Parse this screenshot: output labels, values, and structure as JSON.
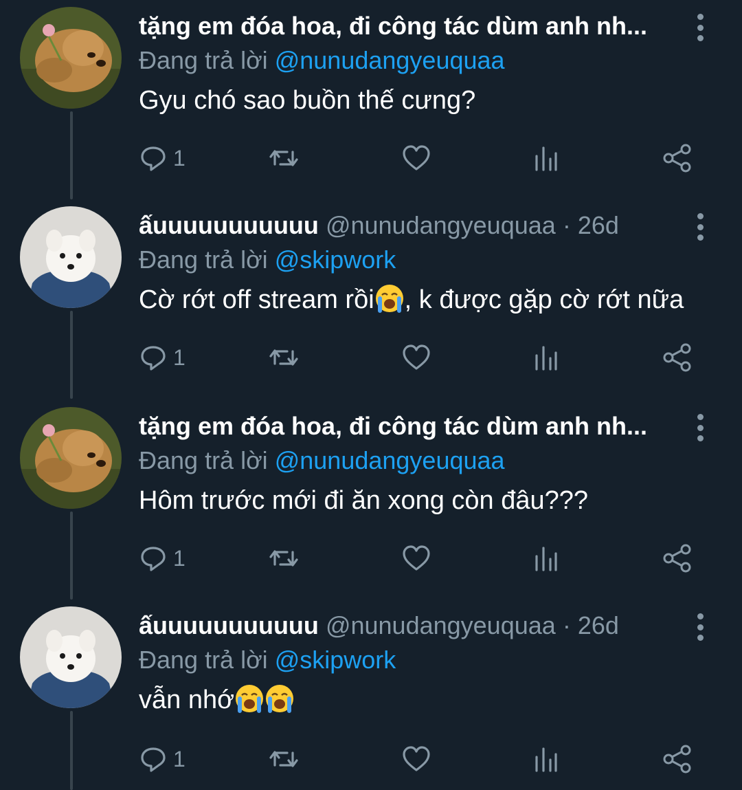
{
  "tweets": [
    {
      "display_name": "tặng em đóa hoa, đi công tác dùm anh nh...",
      "handle": "",
      "time": "",
      "reply_prefix": "Đang trả lời",
      "reply_target": "@nunudangyeuquaa",
      "text_before": "Gyu chó sao buồn thế cưng?",
      "emojis": 0,
      "text_after": "",
      "reply_count": "1",
      "avatar": "golden-retriever-avatar"
    },
    {
      "display_name": "ấuuuuuuuuuuu",
      "handle": "@nunudangyeuquaa",
      "time": "26d",
      "reply_prefix": "Đang trả lời",
      "reply_target": "@skipwork",
      "text_before": "Cờ rớt off stream rồi",
      "emojis": 1,
      "text_after": ", k được gặp cờ rớt nữa",
      "reply_count": "1",
      "avatar": "samoyed-avatar"
    },
    {
      "display_name": "tặng em đóa hoa, đi công tác dùm anh nh...",
      "handle": "",
      "time": "",
      "reply_prefix": "Đang trả lời",
      "reply_target": "@nunudangyeuquaa",
      "text_before": "Hôm trước mới đi ăn xong còn đâu???",
      "emojis": 0,
      "text_after": "",
      "reply_count": "1",
      "avatar": "golden-retriever-avatar"
    },
    {
      "display_name": "ấuuuuuuuuuuu",
      "handle": "@nunudangyeuquaa",
      "time": "26d",
      "reply_prefix": "Đang trả lời",
      "reply_target": "@skipwork",
      "text_before": "vẫn nhớ",
      "emojis": 2,
      "text_after": "",
      "reply_count": "1",
      "avatar": "samoyed-avatar"
    }
  ],
  "separator": "·",
  "icons": [
    "reply-icon",
    "retweet-icon",
    "like-icon",
    "analytics-icon",
    "share-icon",
    "more-options-icon",
    "loudly-crying-face-emoji"
  ],
  "colors": {
    "background": "#15202b",
    "text": "#ffffff",
    "muted": "#8899a6",
    "link": "#1da1f2",
    "thread_line": "#38444d"
  }
}
